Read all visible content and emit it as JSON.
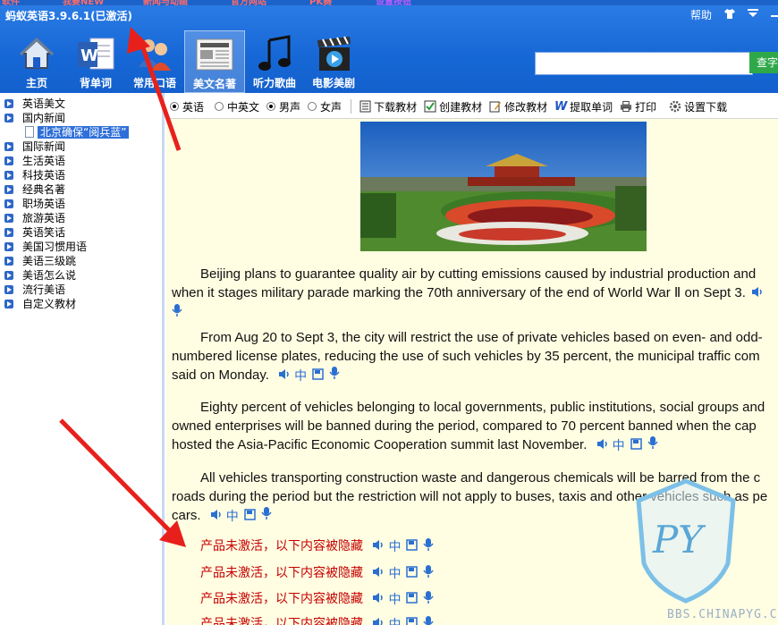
{
  "top_strip": [
    "软件",
    "我要NEW",
    "新闻与动画",
    "官方网站",
    "PK赛",
    "设置按钮"
  ],
  "app": {
    "title": "蚂蚁英语3.9.6.1(已激活)",
    "help": "帮助",
    "shirt_icon": "shirt-icon",
    "menu_icon": "menu-down-icon",
    "minimize_icon": "minimize-icon"
  },
  "nav": [
    {
      "label": "主页",
      "icon": "home-icon"
    },
    {
      "label": "背单词",
      "icon": "word-doc-icon"
    },
    {
      "label": "常用口语",
      "icon": "people-icon"
    },
    {
      "label": "美文名著",
      "icon": "newspaper-icon"
    },
    {
      "label": "听力歌曲",
      "icon": "music-note-icon"
    },
    {
      "label": "电影美剧",
      "icon": "clapperboard-icon"
    }
  ],
  "search": {
    "placeholder": "",
    "button": "查字"
  },
  "tree": [
    {
      "label": "英语美文"
    },
    {
      "label": "国内新闻"
    },
    {
      "label": "北京确保“阅兵蓝”",
      "child": true
    },
    {
      "label": "国际新闻"
    },
    {
      "label": "生活英语"
    },
    {
      "label": "科技英语"
    },
    {
      "label": "经典名著"
    },
    {
      "label": "职场英语"
    },
    {
      "label": "旅游英语"
    },
    {
      "label": "英语笑话"
    },
    {
      "label": "美国习惯用语"
    },
    {
      "label": "美语三级跳"
    },
    {
      "label": "美语怎么说"
    },
    {
      "label": "流行美语"
    },
    {
      "label": "自定义教材"
    }
  ],
  "toolbar": {
    "radio_english": "英语",
    "radio_bilingual": "中英文",
    "radio_male": "男声",
    "radio_female": "女声",
    "download": "下载教材",
    "create": "创建教材",
    "modify": "修改教材",
    "extract": "提取单词",
    "print": "打印",
    "settings": "设置下载"
  },
  "article": {
    "zh_label": "中",
    "p1": [
      "Beijing plans to guarantee quality air by cutting emissions caused by industrial production and",
      "when it stages military parade marking the 70th anniversary of the end of World War Ⅱ on Sept 3."
    ],
    "p2": [
      "From Aug 20 to Sept 3, the city will restrict the use of private vehicles based on even- and odd-",
      "numbered license plates, reducing the use of such vehicles by 35 percent, the municipal traffic com",
      "said on Monday."
    ],
    "p3": [
      "Eighty percent of vehicles belonging to local governments, public institutions, social groups and",
      "owned enterprises will be banned during the period, compared to 70 percent banned when the cap",
      "hosted the Asia-Pacific Economic Cooperation summit last November."
    ],
    "p4": [
      "All vehicles transporting construction waste and dangerous chemicals will be barred from the c",
      "roads during the period but the restriction will not apply to buses, taxis and other vehicles such as pe",
      "cars."
    ],
    "locked": [
      "产品未激活，以下内容被隐藏",
      "产品未激活，以下内容被隐藏",
      "产品未激活，以下内容被隐藏",
      "产品未激活，以下内容被隐藏"
    ]
  },
  "watermark": {
    "text": "BBS.CHINAPYG.COM",
    "logo": "PY"
  },
  "colors": {
    "header_blue": "#1667d6",
    "article_bg": "#fffde2",
    "locked_red": "#c60000",
    "arrow_red": "#e8201c"
  }
}
